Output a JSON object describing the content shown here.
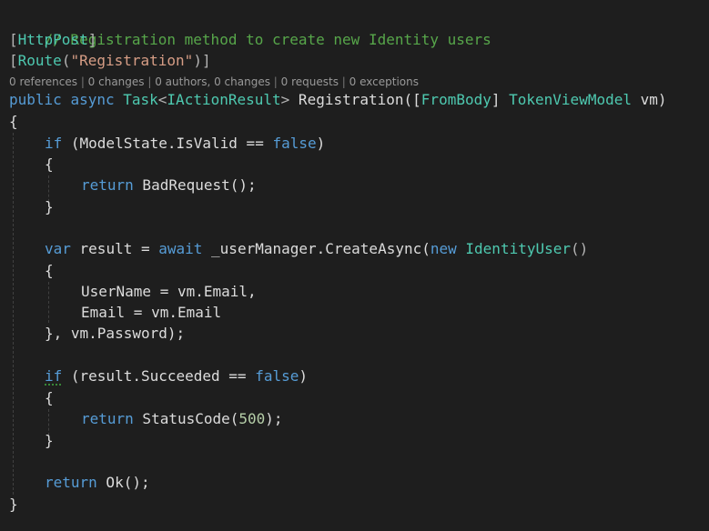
{
  "code": {
    "comment": "// Registration method to create new Identity users",
    "attr_post_open": "[",
    "attr_post_name": "HttpPost",
    "attr_post_close": "]",
    "attr_route_open": "[",
    "attr_route_name": "Route",
    "attr_route_paren_open": "(",
    "attr_route_arg": "\"Registration\"",
    "attr_route_close": ")]",
    "sig_public": "public",
    "sig_async": "async",
    "sig_task": "Task",
    "sig_lt": "<",
    "sig_iaction": "IActionResult",
    "sig_gt": ">",
    "sig_name": " Registration([",
    "sig_frombody": "FromBody",
    "sig_mid": "] ",
    "sig_token": "TokenViewModel",
    "sig_end": " vm)",
    "brace_open": "{",
    "brace_close": "}",
    "if1_kw": "if",
    "if1_cond": " (ModelState.IsValid == ",
    "if1_false": "false",
    "if1_end": ")",
    "ret1_kw": "return",
    "ret1_rest": " BadRequest();",
    "var_kw": "var",
    "var_mid": " result = ",
    "await_kw": "await",
    "var_call": " _userManager.CreateAsync(",
    "new_kw": "new",
    "identity_type": "IdentityUser",
    "parens": "()",
    "init_user": "UserName = vm.Email,",
    "init_email": "Email = vm.Email",
    "init_close": "}, vm.Password);",
    "if2_kw": "if",
    "if2_cond": " (result.Succeeded == ",
    "if2_false": "false",
    "if2_end": ")",
    "ret2_kw": "return",
    "ret2_call": " StatusCode(",
    "ret2_num": "500",
    "ret2_end": ");",
    "ret3_kw": "return",
    "ret3_rest": " Ok();"
  },
  "codelens": {
    "references": "0 references",
    "changes": "0 changes",
    "authors": "0 authors, 0 changes",
    "requests": "0 requests",
    "exceptions": "0 exceptions",
    "separator": " | "
  }
}
